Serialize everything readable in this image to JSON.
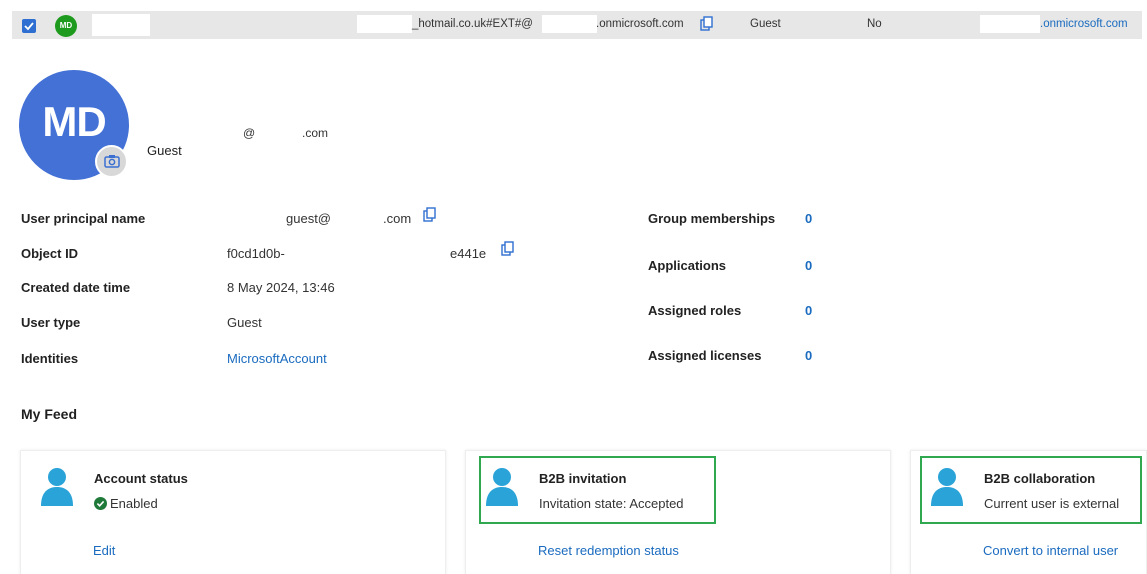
{
  "top_row": {
    "avatar_initials": "MD",
    "email_fragment_1": "_hotmail.co.uk#EXT#@",
    "email_fragment_2": ".onmicrosoft.com",
    "user_type": "Guest",
    "column_value": "No",
    "domain_link": ".onmicrosoft.com"
  },
  "profile": {
    "avatar_initials": "MD",
    "user_type": "Guest",
    "upn_at": "@",
    "upn_domain": ".com"
  },
  "properties": {
    "upn_label": "User principal name",
    "upn_value_1": "guest@",
    "upn_value_2": ".com",
    "object_id_label": "Object ID",
    "object_id_value_1": "f0cd1d0b-",
    "object_id_value_2": "e441e",
    "created_label": "Created date time",
    "created_value": "8 May 2024, 13:46",
    "user_type_label": "User type",
    "user_type_value": "Guest",
    "identities_label": "Identities",
    "identities_value": "MicrosoftAccount"
  },
  "counts": {
    "groups_label": "Group memberships",
    "groups_value": "0",
    "apps_label": "Applications",
    "apps_value": "0",
    "roles_label": "Assigned roles",
    "roles_value": "0",
    "licenses_label": "Assigned licenses",
    "licenses_value": "0"
  },
  "feed": {
    "title": "My Feed",
    "cards": [
      {
        "title": "Account status",
        "text": "Enabled",
        "action": "Edit"
      },
      {
        "title": "B2B invitation",
        "text": "Invitation state: Accepted",
        "action": "Reset redemption status"
      },
      {
        "title": "B2B collaboration",
        "text": "Current user is external",
        "action": "Convert to internal user"
      }
    ]
  },
  "icons": {
    "checkbox": "checkbox-checked-icon",
    "copy": "copy-icon",
    "camera": "camera-icon",
    "person": "person-icon",
    "status": "check-circle-icon"
  },
  "colors": {
    "accent": "#1a6bbf",
    "avatar": "#4471d6",
    "mini_avatar": "#1e9b1e",
    "highlight": "#2fa84f",
    "enabled": "#1f7a3a"
  }
}
